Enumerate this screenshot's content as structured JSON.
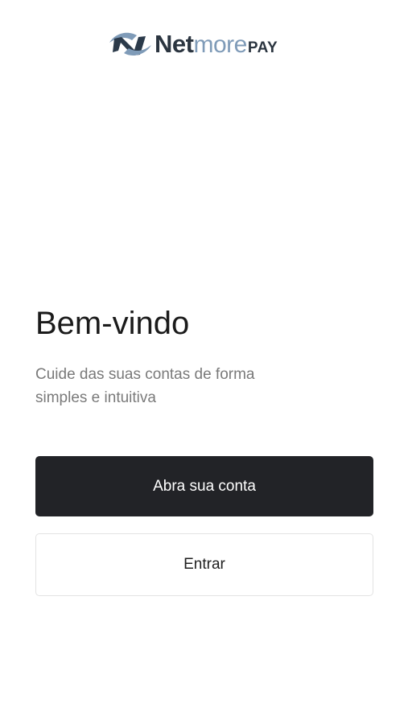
{
  "brand": {
    "logo_part_net": "Net",
    "logo_part_more": "more",
    "logo_part_pay": "PAY",
    "icon": "netmore-logo-icon",
    "colors": {
      "dark": "#2b3a4a",
      "light_blue": "#7f9bb8",
      "text_dark": "#2b3540"
    }
  },
  "welcome": {
    "title": "Bem-vindo",
    "subtitle": "Cuide das suas contas de forma simples e intuitiva"
  },
  "actions": {
    "open_account_label": "Abra sua conta",
    "login_label": "Entrar"
  },
  "colors": {
    "primary_button": "#222327",
    "secondary_button_border": "#e3e3e3",
    "subtitle_text": "#7a7a7a"
  }
}
